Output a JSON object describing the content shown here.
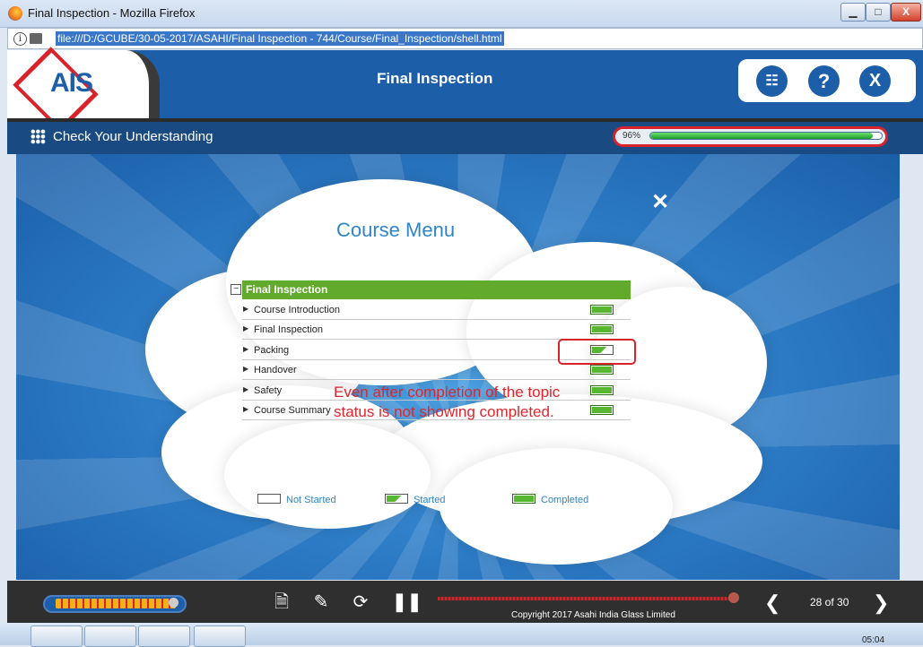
{
  "window": {
    "title": "Final Inspection - Mozilla Firefox",
    "minimize": "▁",
    "maximize": "□",
    "close": "X"
  },
  "address_bar": {
    "url": "file:///D:/GCUBE/30-05-2017/ASAHI/Final Inspection - 744/Course/Final_Inspection/shell.html",
    "info_glyph": "i"
  },
  "header": {
    "logo_text": "AIS",
    "course_title": "Final Inspection",
    "buttons": {
      "sitemap": "☷",
      "help": "?",
      "exit": "X"
    }
  },
  "subheader": {
    "section_title": "Check Your Understanding",
    "progress_label": "96%",
    "progress_value": 0.96
  },
  "course_menu": {
    "title": "Course Menu",
    "close_glyph": "✕",
    "group": {
      "label": "Final Inspection",
      "toggle": "−"
    },
    "items": [
      {
        "label": "Course Introduction",
        "status": "completed"
      },
      {
        "label": "Final Inspection",
        "status": "completed"
      },
      {
        "label": "Packing",
        "status": "started"
      },
      {
        "label": "Handover",
        "status": "completed"
      },
      {
        "label": "Safety",
        "status": "completed"
      },
      {
        "label": "Course Summary",
        "status": "completed"
      }
    ],
    "legend": {
      "not_started": "Not Started",
      "started": "Started",
      "completed": "Completed"
    }
  },
  "annotation": {
    "text": "Even after completion of the topic status is not showing completed."
  },
  "footer": {
    "copyright": "Copyright 2017 Asahi India Glass Limited",
    "page_counter": "28 of 30",
    "prev": "❮",
    "next": "❯",
    "notes": "🗎",
    "edit": "✎",
    "replay": "⟳",
    "pause": "❚❚"
  },
  "taskbar": {
    "clock": "05:04"
  },
  "colors": {
    "brand_blue": "#1d5ea8",
    "brand_red": "#d8232a",
    "completed_green": "#56b830",
    "menu_header_green": "#62aa2b"
  }
}
